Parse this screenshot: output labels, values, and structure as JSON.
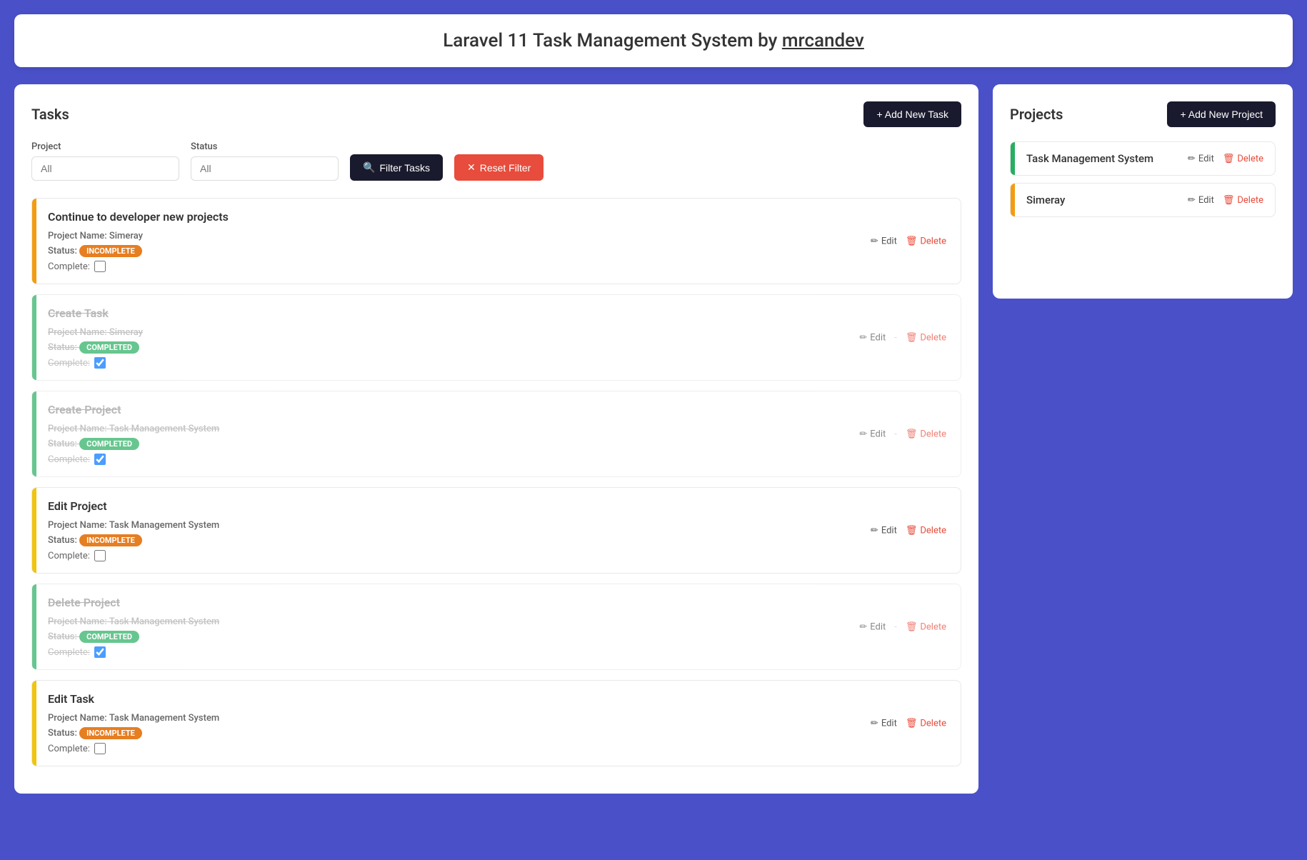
{
  "header": {
    "title": "Laravel 11 Task Management System by ",
    "author": "mrcandev"
  },
  "tasks_panel": {
    "title": "Tasks",
    "add_button": "+ Add New Task",
    "filter": {
      "project_label": "Project",
      "project_placeholder": "All",
      "status_label": "Status",
      "status_placeholder": "All",
      "filter_button": "Filter Tasks",
      "reset_button": "Reset Filter"
    },
    "tasks": [
      {
        "id": 1,
        "title": "Continue to developer new projects",
        "project_label": "Project Name:",
        "project_value": "Simeray",
        "status_label": "Status:",
        "status_value": "INCOMPLETE",
        "status_type": "incomplete",
        "complete_label": "Complete:",
        "is_complete": false,
        "strikethrough": false,
        "color": "orange"
      },
      {
        "id": 2,
        "title": "Create Task",
        "project_label": "Project Name:",
        "project_value": "Simeray",
        "status_label": "Status:",
        "status_value": "COMPLETED",
        "status_type": "completed",
        "complete_label": "Complete:",
        "is_complete": true,
        "strikethrough": true,
        "color": "green"
      },
      {
        "id": 3,
        "title": "Create Project",
        "project_label": "Project Name:",
        "project_value": "Task Management System",
        "status_label": "Status:",
        "status_value": "COMPLETED",
        "status_type": "completed",
        "complete_label": "Complete:",
        "is_complete": true,
        "strikethrough": true,
        "color": "green"
      },
      {
        "id": 4,
        "title": "Edit Project",
        "project_label": "Project Name:",
        "project_value": "Task Management System",
        "status_label": "Status:",
        "status_value": "INCOMPLETE",
        "status_type": "incomplete",
        "complete_label": "Complete:",
        "is_complete": false,
        "strikethrough": false,
        "color": "yellow"
      },
      {
        "id": 5,
        "title": "Delete Project",
        "project_label": "Project Name:",
        "project_value": "Task Management System",
        "status_label": "Status:",
        "status_value": "COMPLETED",
        "status_type": "completed",
        "complete_label": "Complete:",
        "is_complete": true,
        "strikethrough": true,
        "color": "green"
      },
      {
        "id": 6,
        "title": "Edit Task",
        "project_label": "Project Name:",
        "project_value": "Task Management System",
        "status_label": "Status:",
        "status_value": "INCOMPLETE",
        "status_type": "incomplete",
        "complete_label": "Complete:",
        "is_complete": false,
        "strikethrough": false,
        "color": "yellow"
      }
    ],
    "edit_label": "Edit",
    "delete_label": "Delete"
  },
  "projects_panel": {
    "title": "Projects",
    "add_button": "+ Add New Project",
    "projects": [
      {
        "id": 1,
        "name": "Task Management System",
        "color": "green",
        "edit_label": "Edit",
        "delete_label": "Delete"
      },
      {
        "id": 2,
        "name": "Simeray",
        "color": "orange",
        "edit_label": "Edit",
        "delete_label": "Delete"
      }
    ]
  },
  "icons": {
    "search": "🔍",
    "plus": "+",
    "close": "✕",
    "pencil": "✏",
    "trash": "🗑"
  }
}
